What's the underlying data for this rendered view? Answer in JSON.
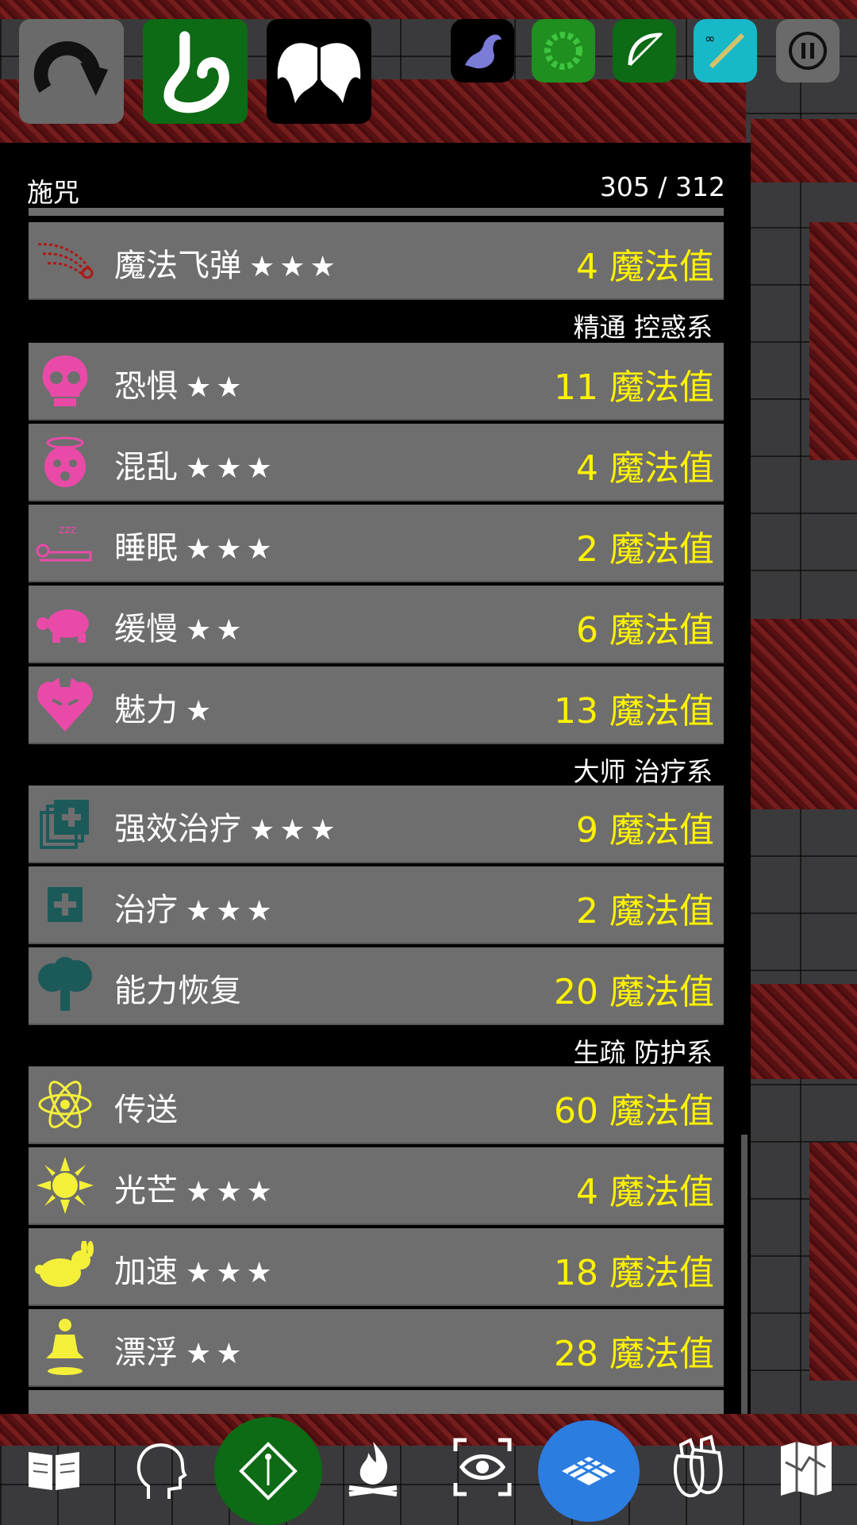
{
  "panel": {
    "title": "施咒",
    "mana": "305 / 312"
  },
  "spells_top": [
    {
      "name": "魔法飞弹",
      "stars": "★★★",
      "cost": "4 魔法值",
      "icon": "magic-missile-icon"
    }
  ],
  "sections": [
    {
      "label": "精通 控惑系"
    },
    {
      "label": "大师 治疗系"
    },
    {
      "label": "生疏 防护系"
    }
  ],
  "spells_enchant": [
    {
      "name": "恐惧",
      "stars": "★★",
      "cost": "11 魔法值",
      "icon": "skull-icon"
    },
    {
      "name": "混乱",
      "stars": "★★★",
      "cost": "4 魔法值",
      "icon": "dizzy-face-icon"
    },
    {
      "name": "睡眠",
      "stars": "★★★",
      "cost": "2 魔法值",
      "icon": "sleep-icon"
    },
    {
      "name": "缓慢",
      "stars": "★★",
      "cost": "6 魔法值",
      "icon": "turtle-icon"
    },
    {
      "name": "魅力",
      "stars": "★",
      "cost": "13 魔法值",
      "icon": "heart-devil-icon"
    }
  ],
  "spells_heal": [
    {
      "name": "强效治疗",
      "stars": "★★★",
      "cost": "9 魔法值",
      "icon": "medkit-stack-icon"
    },
    {
      "name": "治疗",
      "stars": "★★★",
      "cost": "2 魔法值",
      "icon": "medkit-icon"
    },
    {
      "name": "能力恢复",
      "stars": "",
      "cost": "20 魔法值",
      "icon": "tree-icon"
    }
  ],
  "spells_protect": [
    {
      "name": "传送",
      "stars": "",
      "cost": "60 魔法值",
      "icon": "atom-icon"
    },
    {
      "name": "光芒",
      "stars": "★★★",
      "cost": "4 魔法值",
      "icon": "sun-icon"
    },
    {
      "name": "加速",
      "stars": "★★★",
      "cost": "18 魔法值",
      "icon": "rabbit-icon"
    },
    {
      "name": "漂浮",
      "stars": "★★",
      "cost": "28 魔法值",
      "icon": "levitate-icon"
    }
  ],
  "colors": {
    "cost": "#fff200",
    "enchant": "#e94aa8",
    "heal": "#1c5a5a",
    "protect": "#f4f03a",
    "row_bg": "#6e6e6e"
  },
  "top_buttons": [
    "redo-icon",
    "stomach-icon",
    "wings-icon",
    "dragon-icon",
    "gear-green-icon",
    "bow-icon",
    "infinite-sword-icon",
    "pause-icon"
  ],
  "bottom_buttons": [
    "spellbook-icon",
    "head-icon",
    "wand-diamond-icon",
    "campfire-icon",
    "eye-focus-icon",
    "grid-tile-icon",
    "inventory-bags-icon",
    "map-icon"
  ]
}
